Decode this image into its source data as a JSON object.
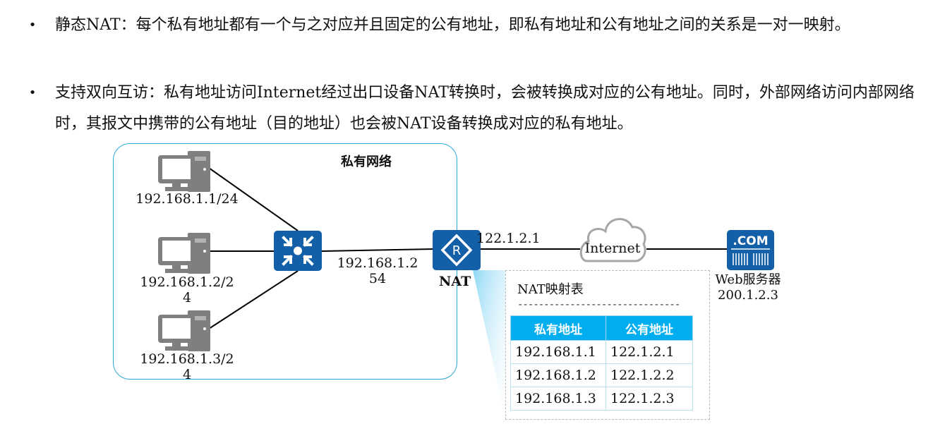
{
  "bullets": [
    {
      "icon": "bullet-dot",
      "symbol": "•",
      "text": "静态NAT：每个私有地址都有一个与之对应并且固定的公有地址，即私有地址和公有地址之间的关系是一对一映射。"
    },
    {
      "icon": "bullet-dot",
      "symbol": "•",
      "text": "支持双向互访：私有地址访问Internet经过出口设备NAT转换时，会被转换成对应的公有地址。同时，外部网络访问内部网络时，其报文中携带的公有地址（目的地址）也会被NAT设备转换成对应的私有地址。"
    }
  ],
  "diagram": {
    "private_network_label": "私有网络",
    "hosts": [
      {
        "icon": "pc-icon",
        "label_line1": "192.168.1.1/24",
        "label_line2": ""
      },
      {
        "icon": "pc-icon",
        "label_line1": "192.168.1.2/2",
        "label_line2": "4"
      },
      {
        "icon": "pc-icon",
        "label_line1": "192.168.1.3/2",
        "label_line2": "4"
      }
    ],
    "switch": {
      "icon": "switch-icon"
    },
    "gateway_label_line1": "192.168.1.2",
    "gateway_label_line2": "54",
    "nat_device": {
      "icon": "router-icon",
      "label": "NAT",
      "public_ip": "122.1.2.1"
    },
    "internet": {
      "icon": "cloud-icon",
      "label": "Internet"
    },
    "web_server": {
      "icon": "server-com-icon",
      "badge": ".COM",
      "name": "Web服务器",
      "ip": "200.1.2.3"
    },
    "mapping_table": {
      "title": "NAT映射表",
      "separator": "-------------------------------",
      "headers": [
        "私有地址",
        "公有地址"
      ],
      "rows": [
        [
          "192.168.1.1",
          "122.1.2.1"
        ],
        [
          "192.168.1.2",
          "122.1.2.2"
        ],
        [
          "192.168.1.3",
          "122.1.2.3"
        ]
      ]
    },
    "colors": {
      "device_blue": "#1460a8",
      "border_cyan": "#2ca9d8",
      "table_header": "#00aeef",
      "pc_gray": "#7f7f7f"
    }
  }
}
